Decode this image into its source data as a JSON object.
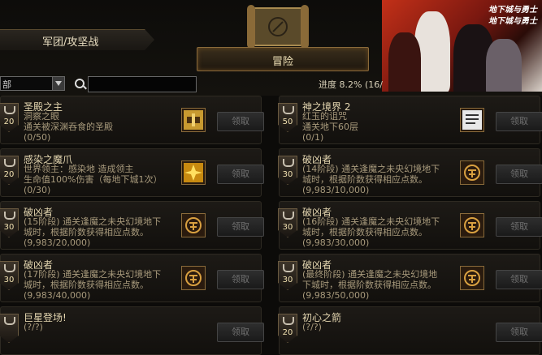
{
  "nav": {
    "left_tab": "军团/攻坚战",
    "main_tab": "冒险"
  },
  "banner": {
    "logo_line1": "地下城与勇士",
    "logo_line2": "地下城与勇士"
  },
  "filter": {
    "selected": "部"
  },
  "search": {
    "placeholder": ""
  },
  "progress_text": "进度  8.2% (16/",
  "colors": {
    "accent": "#8a6a3a",
    "bg": "#0c0b09",
    "text": "#d8c9a0"
  },
  "achievements": [
    {
      "points": "20",
      "title": "圣殿之主",
      "desc": "洞察之眼\n通关被深渊吞食的圣殿\n(0/50)",
      "icon": "sanctum-icon",
      "button": "领取"
    },
    {
      "points": "50",
      "title": "神之境界 2",
      "desc": "红玉的诅咒\n通关地下60层\n(0/1)",
      "icon": "scroll-document-icon",
      "button": "领取"
    },
    {
      "points": "20",
      "title": "感染之魔爪",
      "desc": "世界领主：感染地     造成领主\n生命值100%伤害（每地下城1次）\n(0/30)",
      "icon": "starburst-icon",
      "button": "领取"
    },
    {
      "points": "30",
      "title": "破凶者",
      "desc": "(14阶段) 通关逢魔之未央幻境地下\n城时，根据阶数获得相应点数。\n(9,983/10,000)",
      "icon": "emblem-icon",
      "button": "领取"
    },
    {
      "points": "30",
      "title": "破凶者",
      "desc": "(15阶段) 通关逢魔之未央幻境地下\n城时，根据阶数获得相应点数。\n(9,983/20,000)",
      "icon": "emblem-icon",
      "button": "领取"
    },
    {
      "points": "30",
      "title": "破凶者",
      "desc": "(16阶段) 通关逢魔之未央幻境地下\n城时，根据阶数获得相应点数。\n(9,983/30,000)",
      "icon": "emblem-icon",
      "button": "领取"
    },
    {
      "points": "30",
      "title": "破凶者",
      "desc": "(17阶段) 通关逢魔之未央幻境地下\n城时，根据阶数获得相应点数。\n(9,983/40,000)",
      "icon": "emblem-icon",
      "button": "领取"
    },
    {
      "points": "30",
      "title": "破凶者",
      "desc": "(最终阶段) 通关逢魔之未央幻境地\n下城时，根据阶数获得相应点数。\n(9,983/50,000)",
      "icon": "emblem-icon",
      "button": "领取"
    },
    {
      "points": "",
      "title": "巨星登场!",
      "desc": "(?/?)",
      "icon": "",
      "button": "领取"
    },
    {
      "points": "20",
      "title": "初心之箭",
      "desc": "(?/?)",
      "icon": "",
      "button": "领取"
    }
  ]
}
